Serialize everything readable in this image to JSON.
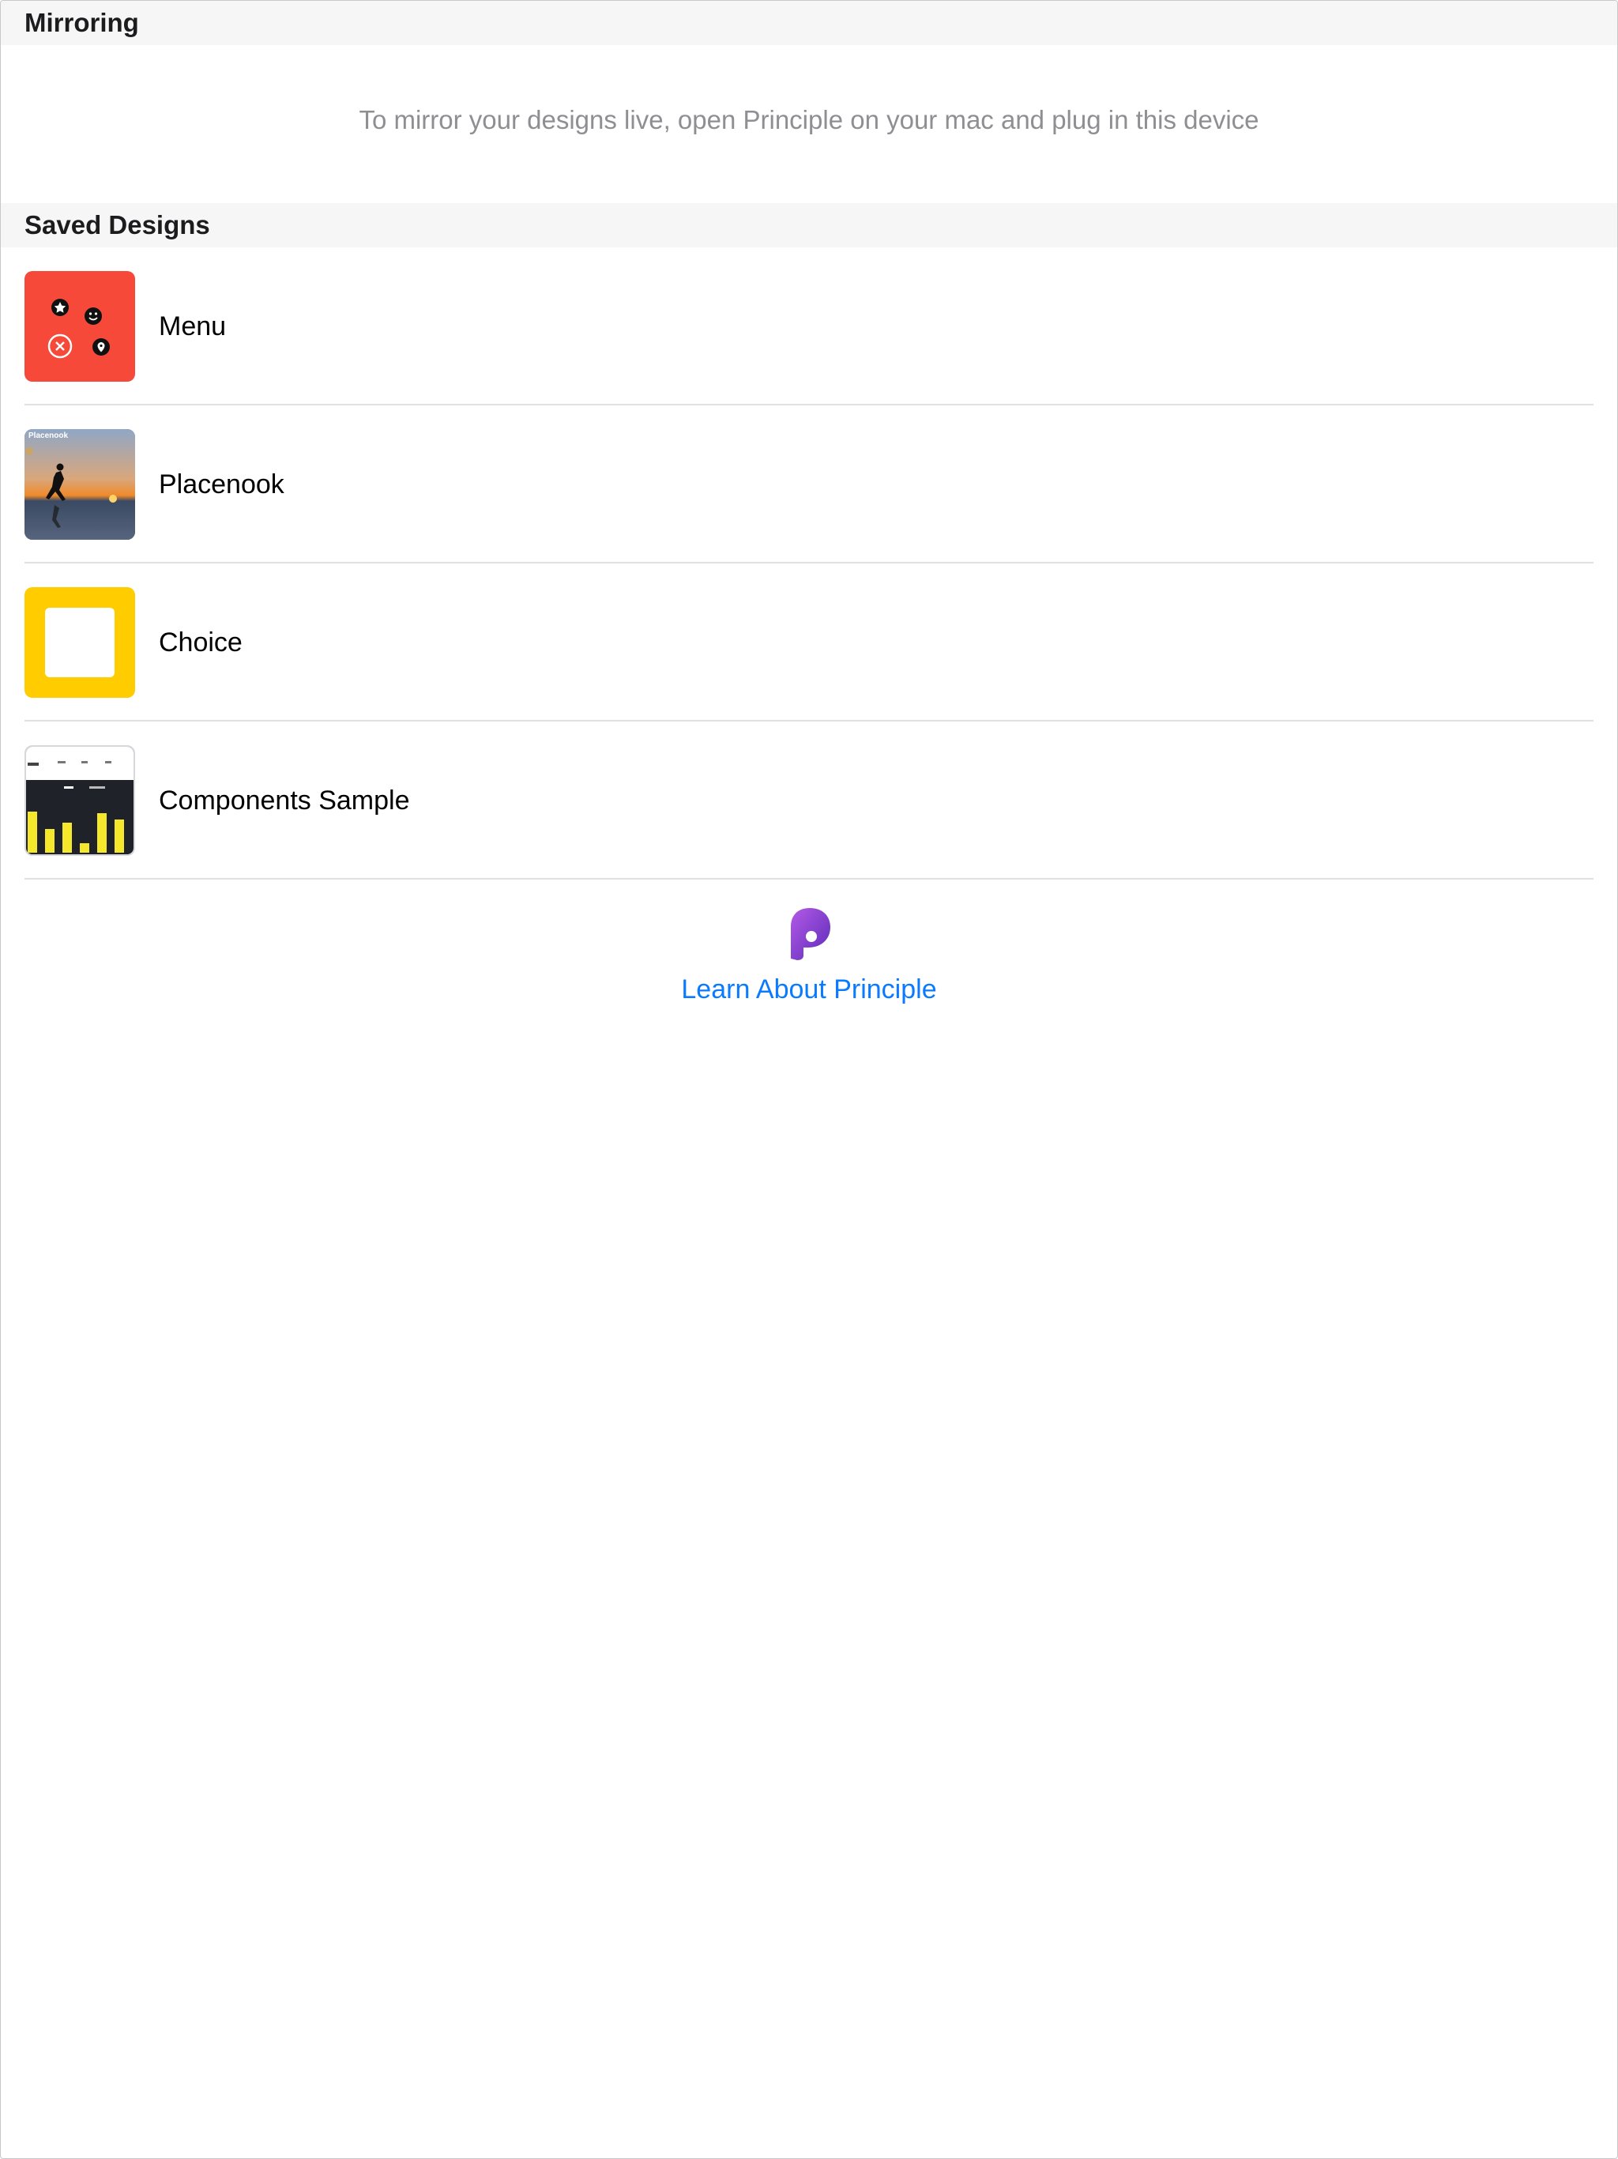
{
  "mirroring": {
    "header": "Mirroring",
    "note": "To mirror your designs live, open Principle on your mac and plug in this device"
  },
  "saved_designs": {
    "header": "Saved Designs",
    "items": [
      {
        "name": "Menu",
        "thumbnail": "menu-thumbnail"
      },
      {
        "name": "Placenook",
        "thumbnail": "placenook-thumbnail",
        "thumbnail_text": "Placenook"
      },
      {
        "name": "Choice",
        "thumbnail": "choice-thumbnail"
      },
      {
        "name": "Components Sample",
        "thumbnail": "components-thumbnail"
      }
    ]
  },
  "footer": {
    "logo": "principle-logo-icon",
    "link_label": "Learn About Principle"
  },
  "colors": {
    "link": "#0a7aff",
    "header_bg": "#f6f6f6",
    "menu_thumb": "#f6493a",
    "choice_thumb": "#ffcc00",
    "components_bar": "#f5e72c",
    "logo": "#8e3fd6"
  }
}
